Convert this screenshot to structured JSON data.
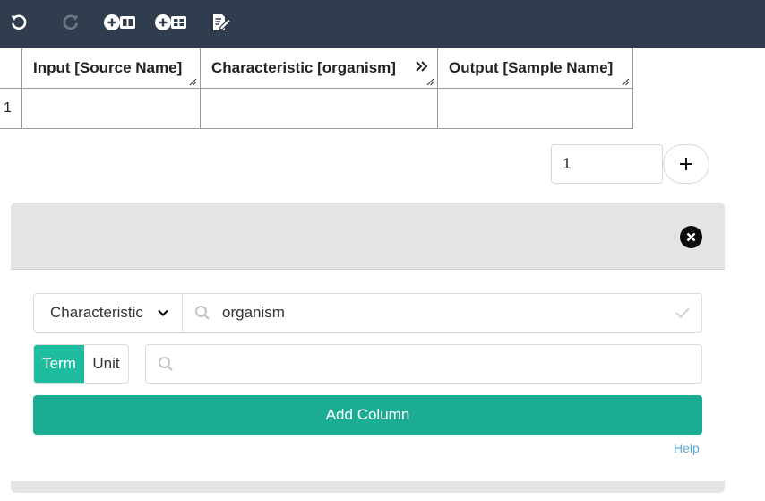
{
  "toolbar": {
    "undo_icon": "undo-icon",
    "redo_icon": "redo-icon",
    "add_column_icon": "add-column-icon",
    "add_table_icon": "add-building-block-icon",
    "edit_icon": "edit-document-icon"
  },
  "grid": {
    "columns": [
      "Input [Source Name]",
      "Characteristic [organism]",
      "Output [Sample Name]"
    ],
    "rows": [
      {
        "number": "1",
        "cells": [
          "",
          "",
          ""
        ]
      }
    ]
  },
  "row_adder": {
    "count_value": "1",
    "add_label": "+"
  },
  "modal": {
    "column_type": "Characteristic",
    "term_search_value": "organism",
    "toggle": {
      "term_label": "Term",
      "unit_label": "Unit",
      "selected": "Term"
    },
    "unit_search_value": "",
    "add_column_label": "Add Column",
    "help_label": "Help"
  },
  "colors": {
    "toolbar_bg": "#2f3d4f",
    "accent_primary": "#1bad93",
    "accent_toggle": "#1ebda0",
    "link": "#5fa7d8"
  }
}
